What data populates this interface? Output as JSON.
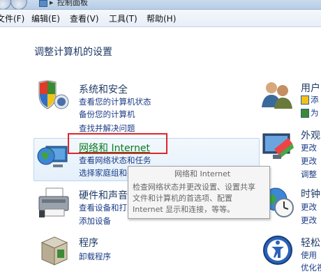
{
  "window": {
    "address_separator": "▸",
    "address_text": "控制面板"
  },
  "menu": {
    "file": "文件(F)",
    "edit": "编辑(E)",
    "view": "查看(V)",
    "tools": "工具(T)",
    "help": "帮助(H)"
  },
  "page_title": "调整计算机的设置",
  "categories": {
    "security": {
      "title": "系统和安全",
      "links": [
        "查看您的计算机状态",
        "备份您的计算机",
        "查找并解决问题"
      ]
    },
    "network": {
      "title": "网络和 Internet",
      "links": [
        "查看网络状态和任务",
        "选择家庭组和共享选项"
      ]
    },
    "hardware": {
      "title": "硬件和声音",
      "links": [
        "查看设备和打印机",
        "添加设备"
      ]
    },
    "programs": {
      "title": "程序",
      "links": [
        "卸载程序"
      ]
    }
  },
  "tooltip": {
    "title": "网络和 Internet",
    "lines": [
      "检查网络状态并更改设置、设置共享",
      "文件和计算机的首选项、配置",
      "Internet 显示和连接，等等。"
    ]
  },
  "right_column": {
    "user": {
      "title": "用户",
      "links": [
        "添",
        "为"
      ]
    },
    "appearance": {
      "title": "外观",
      "links": [
        "更改",
        "更改",
        "调整"
      ]
    },
    "clock": {
      "title": "时钟",
      "links": [
        "更改",
        "更改"
      ]
    },
    "ease": {
      "title": "轻松",
      "links": [
        "使用",
        "优化视"
      ]
    }
  },
  "colors": {
    "accent_red": "#e0242b",
    "hover_green": "#0b7a1f",
    "link_blue": "#1c3c86",
    "title_navy": "#1e3b67"
  }
}
